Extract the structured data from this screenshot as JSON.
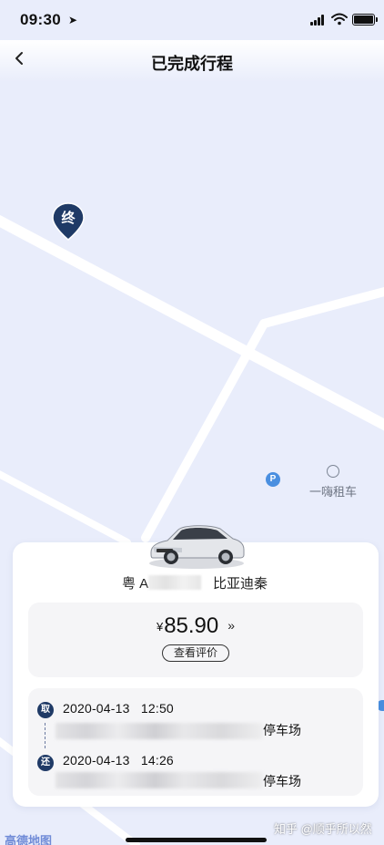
{
  "status_bar": {
    "time": "09:30",
    "location_arrow": "location-arrow-icon",
    "icons": [
      "signal-icon",
      "wifi-icon",
      "battery-icon"
    ]
  },
  "nav": {
    "back_icon": "chevron-left-icon",
    "title": "已完成行程"
  },
  "map": {
    "end_marker_label": "终",
    "parking_label": "P",
    "poi_rental_label": "一嗨租车",
    "provider_logo": "高德地图",
    "colors": {
      "background": "#e9edfb",
      "road": "#ffffff",
      "marker": "#1f3a66",
      "poi_parking": "#4a8fe0"
    }
  },
  "vehicle": {
    "plate_prefix": "粤 A",
    "model": "比亚迪秦"
  },
  "fare": {
    "currency_symbol": "¥",
    "amount": "85.90",
    "more_icon": "»",
    "review_button": "查看评价"
  },
  "trip": {
    "pickup": {
      "badge": "取",
      "datetime": "2020-04-13   12:50",
      "location_suffix": "停车场"
    },
    "return": {
      "badge": "还",
      "datetime": "2020-04-13   14:26",
      "location_suffix": "停车场"
    }
  },
  "watermark": "知乎 @顺乎所以然"
}
